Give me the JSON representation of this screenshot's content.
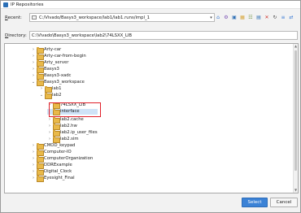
{
  "window": {
    "title": "IP Repositories"
  },
  "recent": {
    "label_prefix": "",
    "label_underlined": "R",
    "label_rest": "ecent:",
    "value": "C:/Vivado/Basys3_workspace/lab1/lab1.runs/impl_1"
  },
  "directory": {
    "label_underlined": "D",
    "label_rest": "irectory:",
    "value": "C:\\Vivado\\Basys3_workspace\\lab2\\74LSXX_LIB"
  },
  "toolbar_icons": [
    "home-icon",
    "settings-icon",
    "desktop-icon",
    "folder-add-icon",
    "hierarchy-icon",
    "network-icon",
    "delete-icon",
    "refresh-icon",
    "collapse-icon",
    "sync-icon"
  ],
  "tree": {
    "items": [
      {
        "label": "Arty-car",
        "expanded": false
      },
      {
        "label": "Arty-car-from-begin",
        "expanded": false
      },
      {
        "label": "Arty_server",
        "expanded": false
      },
      {
        "label": "Basys3",
        "expanded": false
      },
      {
        "label": "Basys3-xadc",
        "expanded": false
      },
      {
        "label": "Basys3_workspace",
        "expanded": true
      },
      {
        "label": "lab1",
        "expanded": false
      },
      {
        "label": "lab2",
        "expanded": true
      },
      {
        "label": "74LSXX_LIB",
        "expanded": false
      },
      {
        "label": "interface",
        "expanded": false
      },
      {
        "label": "lab2.cache",
        "expanded": false
      },
      {
        "label": "lab2.hw",
        "expanded": false
      },
      {
        "label": "lab2.ip_user_files",
        "expanded": false
      },
      {
        "label": "lab2.sim",
        "expanded": false
      },
      {
        "label": "CMOD_keypad",
        "expanded": false
      },
      {
        "label": "Computer-IO",
        "expanded": false
      },
      {
        "label": "ComputerOrganization",
        "expanded": false
      },
      {
        "label": "DDRExample",
        "expanded": false
      },
      {
        "label": "Digital_Clock",
        "expanded": false
      },
      {
        "label": "Eyesight_Final",
        "expanded": false
      }
    ]
  },
  "buttons": {
    "select": "Select",
    "cancel": "Cancel"
  }
}
